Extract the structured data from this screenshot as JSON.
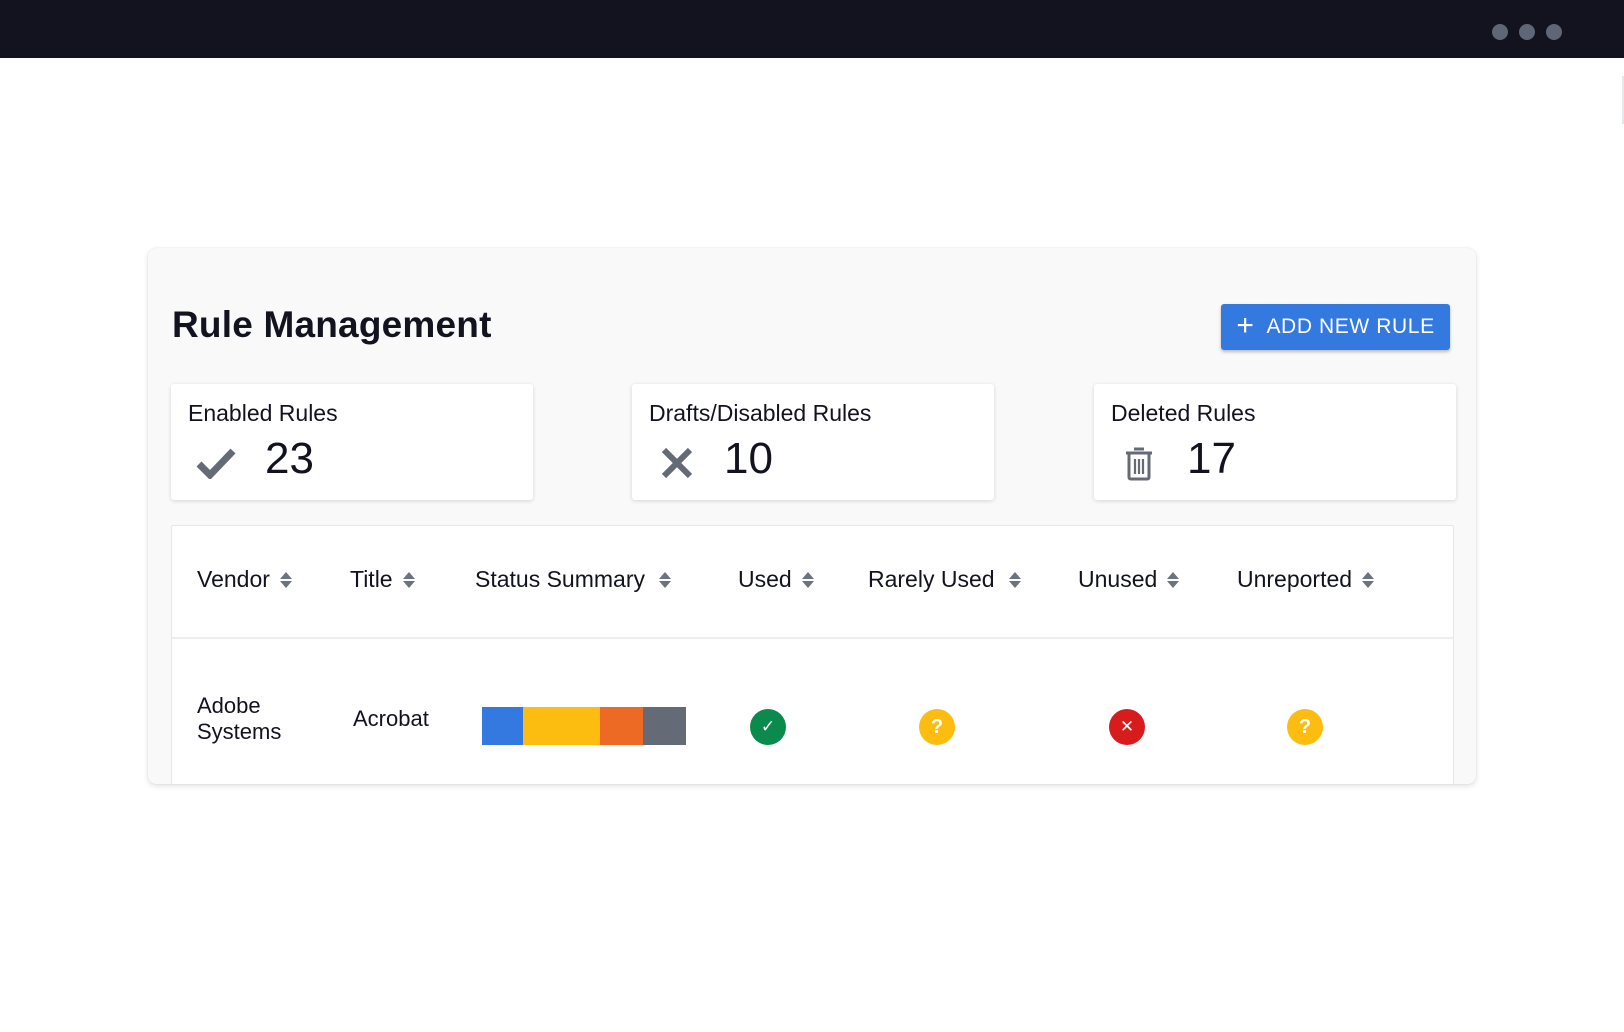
{
  "window": {
    "controls": [
      "dot",
      "dot",
      "dot"
    ]
  },
  "page": {
    "title": "Rule Management",
    "add_button": {
      "icon": "plus-icon",
      "icon_glyph": "+",
      "label": "ADD NEW RULE",
      "color": "#3479e0"
    }
  },
  "stats": [
    {
      "label": "Enabled Rules",
      "value": "23",
      "icon": "checkmark-icon"
    },
    {
      "label": "Drafts/Disabled Rules",
      "value": "10",
      "icon": "x-icon"
    },
    {
      "label": "Deleted Rules",
      "value": "17",
      "icon": "trash-icon"
    }
  ],
  "table": {
    "columns": [
      {
        "label": "Vendor",
        "sortable": true
      },
      {
        "label": "Title",
        "sortable": true
      },
      {
        "label": "Status Summary",
        "sortable": true
      },
      {
        "label": "Used",
        "sortable": true
      },
      {
        "label": "Rarely Used",
        "sortable": true
      },
      {
        "label": "Unused",
        "sortable": true
      },
      {
        "label": "Unreported",
        "sortable": true
      }
    ],
    "rows": [
      {
        "vendor": "Adobe Systems",
        "title": "Acrobat",
        "status_summary": [
          {
            "name": "used",
            "fraction": 0.2,
            "color": "#3479e0"
          },
          {
            "name": "rarely-used",
            "fraction": 0.38,
            "color": "#fdbd10"
          },
          {
            "name": "unused",
            "fraction": 0.21,
            "color": "#ec6a23"
          },
          {
            "name": "unreported",
            "fraction": 0.21,
            "color": "#656b76"
          }
        ],
        "used": {
          "status": "check",
          "glyph": "✓",
          "color": "#0b8a4d"
        },
        "rarely_used": {
          "status": "question",
          "glyph": "?",
          "color": "#fdbd10"
        },
        "unused": {
          "status": "error",
          "glyph": "✕",
          "color": "#d81b1b"
        },
        "unreported": {
          "status": "question",
          "glyph": "?",
          "color": "#fdbd10"
        }
      }
    ]
  }
}
